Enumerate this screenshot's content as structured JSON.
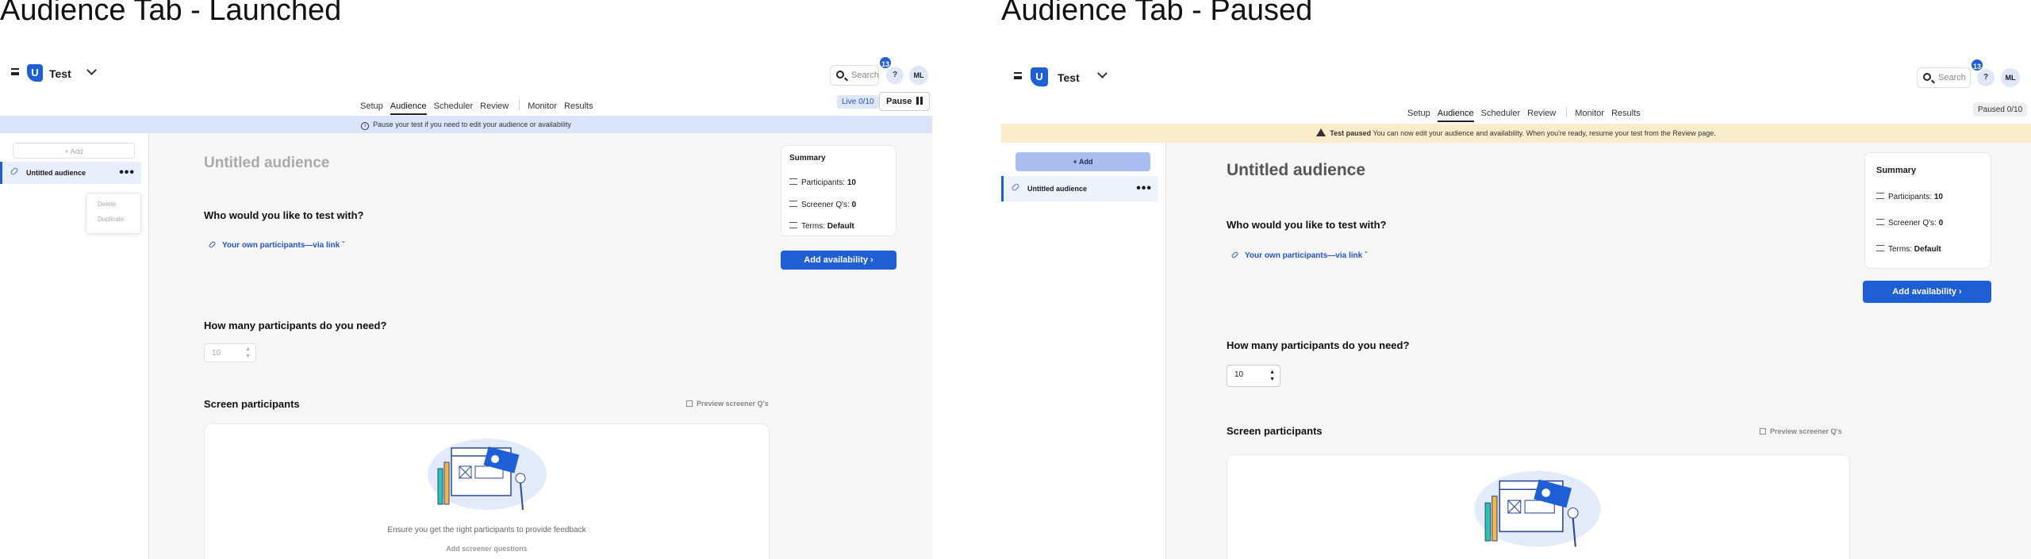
{
  "launched": {
    "title": "Audience Tab - Launched",
    "app": {
      "name": "Test",
      "logo_letter": "U"
    },
    "search_placeholder": "Search",
    "notification_count": "13",
    "help_label": "?",
    "avatar_initials": "ML",
    "tabs": [
      "Setup",
      "Audience",
      "Scheduler",
      "Review",
      "Monitor",
      "Results"
    ],
    "active_tab": "Audience",
    "status_badge": "Live 0/10",
    "pause_label": "Pause",
    "banner": "Pause your test if you need to edit your audience or availability",
    "sidebar": {
      "add_label": "Add",
      "audience_item": "Untitled audience",
      "menu": [
        "Delete",
        "Duplicate"
      ]
    },
    "main": {
      "audience_title": "Untitled audience",
      "q1": "Who would you like to test with?",
      "link_choice": "Your own participants—via link",
      "q2": "How many participants do you need?",
      "participant_count": "10",
      "screen_heading": "Screen participants",
      "preview_label": "Preview screener Q's",
      "card_text": "Ensure you get the right participants to provide feedback",
      "card_link": "Add screener questions"
    },
    "summary": {
      "title": "Summary",
      "participants_label": "Participants:",
      "participants_value": "10",
      "screener_label": "Screener Q's:",
      "screener_value": "0",
      "terms_label": "Terms:",
      "terms_value": "Default",
      "cta": "Add availability"
    }
  },
  "paused": {
    "title": "Audience Tab - Paused",
    "app": {
      "name": "Test",
      "logo_letter": "U"
    },
    "search_placeholder": "Search",
    "notification_count": "13",
    "help_label": "?",
    "avatar_initials": "ML",
    "tabs": [
      "Setup",
      "Audience",
      "Scheduler",
      "Review",
      "Monitor",
      "Results"
    ],
    "active_tab": "Audience",
    "status_badge": "Paused 0/10",
    "banner_strong": "Test paused",
    "banner": "You can now edit your audience and availability. When you're ready, resume your test from the Review page.",
    "sidebar": {
      "add_label": "Add",
      "audience_item": "Untitled audience"
    },
    "main": {
      "audience_title": "Untitled audience",
      "q1": "Who would you like to test with?",
      "link_choice": "Your own participants—via link",
      "q2": "How many participants do you need?",
      "participant_count": "10",
      "screen_heading": "Screen participants",
      "preview_label": "Preview screener Q's"
    },
    "summary": {
      "title": "Summary",
      "participants_label": "Participants:",
      "participants_value": "10",
      "screener_label": "Screener Q's:",
      "screener_value": "0",
      "terms_label": "Terms:",
      "terms_value": "Default",
      "cta": "Add availability"
    }
  },
  "colors": {
    "primary": "#1f5fd6",
    "info_banner": "#d9e4fb",
    "warn_banner": "#fbeccc",
    "sidebar_add_paused": "#a9bdf0",
    "link_blue": "#2553c8"
  }
}
